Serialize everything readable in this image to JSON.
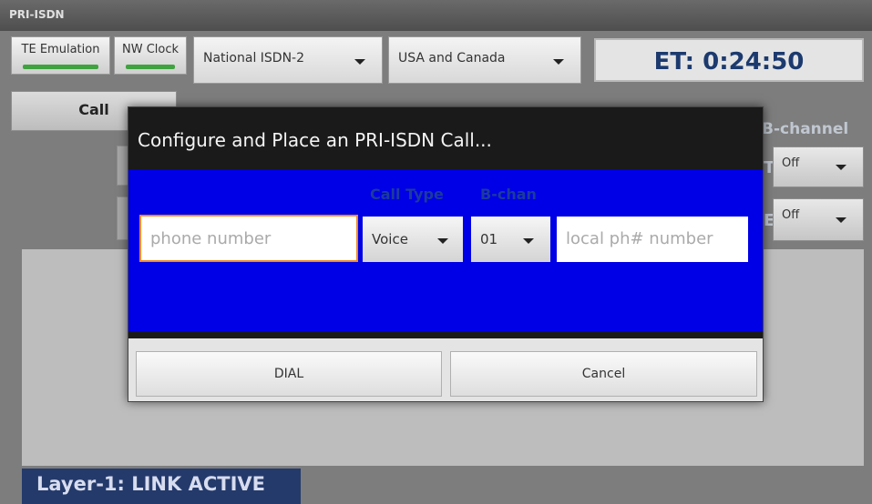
{
  "app": {
    "title": "PRI-ISDN"
  },
  "toolbar": {
    "te_emulation": "TE Emulation",
    "nw_clock": "NW Clock",
    "protocol": "National ISDN-2",
    "region": "USA and Canada",
    "elapsed_time": "ET: 0:24:50"
  },
  "main": {
    "call_button": "Call",
    "bchannel_header": "B-channel",
    "bchannel_rows": [
      {
        "value": "Off"
      },
      {
        "value": "Off"
      }
    ],
    "status": "Layer-1: LINK ACTIVE"
  },
  "dialog": {
    "title": "Configure and Place an PRI-ISDN Call...",
    "call_type_label": "Call Type",
    "bchan_label": "B-chan",
    "phone_placeholder": "phone number",
    "call_type_value": "Voice",
    "bchan_value": "01",
    "local_placeholder": "local ph# number",
    "dial_label": "DIAL",
    "cancel_label": "Cancel"
  },
  "colors": {
    "dialog_body": "#0000e6",
    "status_bar": "#243a6b",
    "focus_border": "#f08a24",
    "indicator_on": "#3fa33f"
  }
}
